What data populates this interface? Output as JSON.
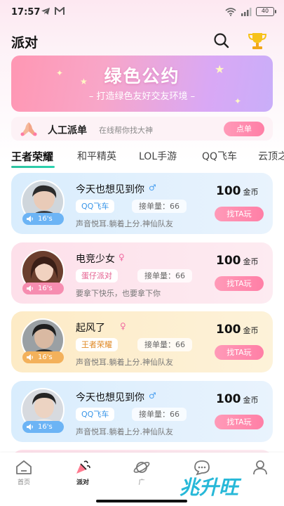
{
  "status": {
    "time": "17:57",
    "battery": "40"
  },
  "header": {
    "title": "派对"
  },
  "banner": {
    "title": "绿色公约",
    "subtitle": "– 打造绿色友好交友环境 –"
  },
  "dispatch": {
    "title": "人工派单",
    "description": "在线帮你找大神",
    "button": "点单"
  },
  "tabs": [
    "王者荣耀",
    "和平精英",
    "LOL手游",
    "QQ飞车",
    "云顶之"
  ],
  "cards": [
    {
      "name": "今天也想见到你",
      "gender": "♂",
      "game": "QQ飞车",
      "orders": "接单量：66",
      "intro": "声音悦耳.躺着上分.神仙队友",
      "duration": "16's",
      "price": "100",
      "unit": "金币",
      "button": "找TA玩",
      "theme": "blue"
    },
    {
      "name": "电竞少女",
      "gender": "♀",
      "game": "蛋仔派对",
      "orders": "接单量：66",
      "intro": "要拿下快乐，也要拿下你",
      "duration": "16's",
      "price": "100",
      "unit": "金币",
      "button": "找TA玩",
      "theme": "pink"
    },
    {
      "name": "起风了",
      "gender": "♀",
      "game": "王者荣耀",
      "orders": "接单量：66",
      "intro": "声音悦耳.躺着上分.神仙队友",
      "duration": "16's",
      "price": "100",
      "unit": "金币",
      "button": "找TA玩",
      "theme": "yellow"
    },
    {
      "name": "今天也想见到你",
      "gender": "♂",
      "game": "QQ飞车",
      "orders": "接单量：66",
      "intro": "声音悦耳.躺着上分.神仙队友",
      "duration": "16's",
      "price": "100",
      "unit": "金币",
      "button": "找TA玩",
      "theme": "blue"
    }
  ],
  "nav": {
    "home": "首页",
    "party": "派对",
    "square": "广",
    "message": "",
    "mine": ""
  },
  "watermark": "兆升旺",
  "colors": {
    "accent": "#ff85aa",
    "tab_underline": "#2ec2a0",
    "male": "#4a9ff0",
    "female": "#f06aa0"
  }
}
